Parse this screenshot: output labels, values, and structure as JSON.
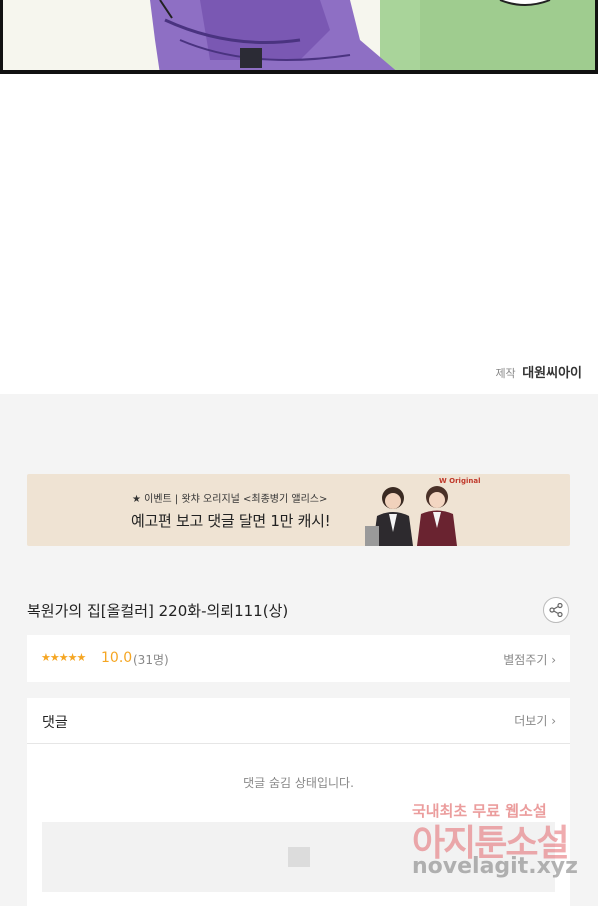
{
  "viewer": {
    "credit_label": "제작",
    "credit_studio": "대원씨아이"
  },
  "banner": {
    "line1": "★ 이벤트 | 왓챠 오리지널 <최종병기 앨리스>",
    "line2": "예고편 보고 댓글 달면 1만 캐시!",
    "logo": "W Original"
  },
  "episode": {
    "title": "복원가의 집[올컬러] 220화-의뢰111(상)"
  },
  "rating": {
    "stars": "★★★★★",
    "score": "10.0",
    "count": "(31명)",
    "rate_link": "별점주기 ›"
  },
  "comments": {
    "title": "댓글",
    "more_link": "더보기 ›",
    "hidden_message": "댓글 숨김 상태입니다."
  },
  "watermark": {
    "line1": "국내최초 무료 웹소설",
    "line2": "아지툰소설",
    "line3": "novelagit.xyz"
  },
  "colors": {
    "accent_star": "#f5a623",
    "banner_bg": "#efe3d3",
    "page_bg": "#f4f4f4"
  }
}
